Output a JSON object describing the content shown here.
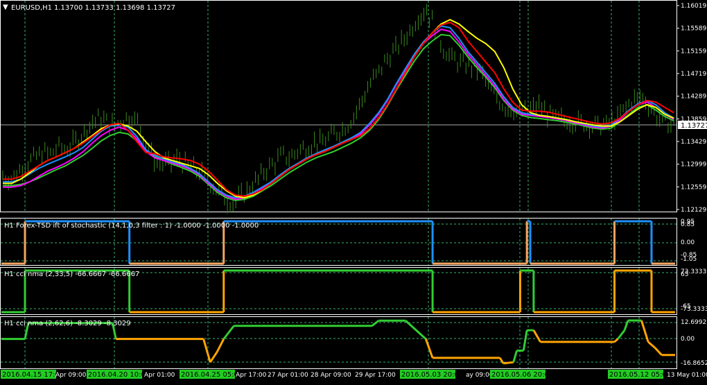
{
  "symbol": "EURUSD,H1",
  "ohlc": "1.13700 1.13733 1.13698 1.13727",
  "current_price": "1.13727",
  "indicators": [
    {
      "label": "H1 Forex-TSD ift of stochastic (14,1,0,3 filter : 1) -1.0000 -1.0000 -1.0000",
      "ticks": [
        "0.95",
        "0.85",
        "0.00",
        "-0.85",
        "-1.05"
      ]
    },
    {
      "label": "H1 cci nma (2,33,5) -66.6667 -66.6667",
      "ticks": [
        "73.3333",
        "65",
        "-65",
        "-73.3333"
      ]
    },
    {
      "label": "H1 cci nma (2,62,6) -8.3029 -8.3029",
      "ticks": [
        "12.6992",
        "0.00",
        "-16.8652"
      ]
    }
  ],
  "colors": {
    "candles": "#3a8a1c",
    "ma_yellow": "#ffff00",
    "ma_red": "#ff0000",
    "ma_blue": "#1e90ff",
    "ma_magenta": "#ff00ff",
    "ma_green": "#32cd32",
    "stoch_up": "#1e90ff",
    "stoch_down": "#f4a460",
    "cci_up": "#32cd32",
    "cci_down": "#ffa500",
    "grid": "#3cb371",
    "time_highlight": "#22cc22"
  },
  "time_labels": [
    {
      "text": "2016.04.15 17:00",
      "highlight": true
    },
    {
      "text": "Apr 09:00",
      "highlight": false
    },
    {
      "text": "2016.04.20 10:00",
      "highlight": true
    },
    {
      "text": "Apr 01:00",
      "highlight": false
    },
    {
      "text": "2016.04.25 05:00",
      "highlight": true
    },
    {
      "text": "Apr 17:00",
      "highlight": false
    },
    {
      "text": "27 Apr 01:00",
      "highlight": false
    },
    {
      "text": "28 Apr 09:00",
      "highlight": false
    },
    {
      "text": "29 Apr 17:00",
      "highlight": false
    },
    {
      "text": "2016.05.03 20:00",
      "highlight": true
    },
    {
      "text": "ay 09:00",
      "highlight": false
    },
    {
      "text": "2016.05.06 20:00",
      "highlight": true
    },
    {
      "text": "2016.05.12 05:00",
      "highlight": true
    },
    {
      "text": "13 May 01:00",
      "highlight": false
    }
  ],
  "chart_data": {
    "type": "line",
    "price_axis": {
      "labels": [
        "1.16019",
        "1.15589",
        "1.15159",
        "1.14719",
        "1.14289",
        "1.13859",
        "1.13429",
        "1.12999",
        "1.12559",
        "1.12129"
      ],
      "min": 1.12129,
      "max": 1.16019
    },
    "price_close": [
      1.1275,
      1.127,
      1.1285,
      1.13,
      1.131,
      1.132,
      1.1318,
      1.133,
      1.1325,
      1.134,
      1.1355,
      1.1375,
      1.1385,
      1.1378,
      1.137,
      1.1382,
      1.139,
      1.1375,
      1.134,
      1.1305,
      1.13,
      1.1298,
      1.131,
      1.1295,
      1.129,
      1.128,
      1.1265,
      1.1245,
      1.123,
      1.1225,
      1.124,
      1.1255,
      1.127,
      1.129,
      1.13,
      1.1315,
      1.131,
      1.1325,
      1.133,
      1.134,
      1.1338,
      1.135,
      1.136,
      1.137,
      1.139,
      1.142,
      1.145,
      1.147,
      1.1495,
      1.151,
      1.153,
      1.155,
      1.1575,
      1.159,
      1.156,
      1.152,
      1.15,
      1.149,
      1.1485,
      1.148,
      1.147,
      1.144,
      1.142,
      1.1405,
      1.14,
      1.1395,
      1.14,
      1.141,
      1.1395,
      1.1385,
      1.1382,
      1.138,
      1.1378,
      1.1375,
      1.1372,
      1.137,
      1.1375,
      1.1385,
      1.1405,
      1.142,
      1.1425,
      1.141,
      1.1385,
      1.1375,
      1.1373
    ],
    "series": [
      {
        "name": "yellow",
        "values": [
          1.1262,
          1.1262,
          1.127,
          1.1282,
          1.1295,
          1.1305,
          1.1312,
          1.132,
          1.1328,
          1.134,
          1.1352,
          1.1365,
          1.1372,
          1.1374,
          1.137,
          1.136,
          1.134,
          1.1322,
          1.131,
          1.1305,
          1.13,
          1.1295,
          1.129,
          1.1278,
          1.1262,
          1.1248,
          1.1238,
          1.1235,
          1.124,
          1.125,
          1.1262,
          1.1275,
          1.1288,
          1.1298,
          1.1308,
          1.1316,
          1.1322,
          1.133,
          1.1338,
          1.1345,
          1.1352,
          1.1365,
          1.1385,
          1.141,
          1.144,
          1.147,
          1.15,
          1.1525,
          1.1545,
          1.1562,
          1.157,
          1.1562,
          1.1548,
          1.1535,
          1.1525,
          1.151,
          1.148,
          1.144,
          1.141,
          1.1395,
          1.139,
          1.1388,
          1.1385,
          1.1382,
          1.1378,
          1.1375,
          1.1372,
          1.137,
          1.137,
          1.1378,
          1.139,
          1.1402,
          1.141,
          1.1405,
          1.1392,
          1.1385
        ]
      },
      {
        "name": "red",
        "values": [
          1.127,
          1.127,
          1.1275,
          1.1285,
          1.1295,
          1.1305,
          1.1312,
          1.132,
          1.1328,
          1.1338,
          1.135,
          1.1362,
          1.1372,
          1.1375,
          1.1362,
          1.134,
          1.132,
          1.1318,
          1.1312,
          1.131,
          1.1308,
          1.1305,
          1.1298,
          1.1285,
          1.1268,
          1.125,
          1.124,
          1.1238,
          1.1242,
          1.125,
          1.1262,
          1.1275,
          1.1288,
          1.1298,
          1.1308,
          1.1316,
          1.1322,
          1.133,
          1.1338,
          1.1345,
          1.1352,
          1.1365,
          1.1385,
          1.141,
          1.144,
          1.147,
          1.15,
          1.1525,
          1.1545,
          1.156,
          1.1565,
          1.1555,
          1.153,
          1.151,
          1.149,
          1.147,
          1.144,
          1.1415,
          1.14,
          1.1398,
          1.1398,
          1.1396,
          1.1392,
          1.1388,
          1.1384,
          1.138,
          1.1376,
          1.1374,
          1.1376,
          1.1385,
          1.1398,
          1.141,
          1.1418,
          1.1415,
          1.1405,
          1.1395
        ]
      },
      {
        "name": "blue",
        "values": [
          1.1265,
          1.1265,
          1.127,
          1.128,
          1.129,
          1.1298,
          1.1305,
          1.1312,
          1.132,
          1.133,
          1.1345,
          1.136,
          1.137,
          1.1372,
          1.1368,
          1.135,
          1.1325,
          1.1315,
          1.1308,
          1.1302,
          1.1298,
          1.129,
          1.128,
          1.1265,
          1.125,
          1.124,
          1.1235,
          1.1238,
          1.1245,
          1.1255,
          1.1265,
          1.1278,
          1.129,
          1.13,
          1.131,
          1.1318,
          1.1325,
          1.1332,
          1.134,
          1.1348,
          1.1358,
          1.1375,
          1.1395,
          1.142,
          1.145,
          1.1478,
          1.1505,
          1.1528,
          1.1545,
          1.1558,
          1.1555,
          1.1535,
          1.151,
          1.149,
          1.147,
          1.145,
          1.1425,
          1.1405,
          1.1395,
          1.1392,
          1.139,
          1.1388,
          1.1385,
          1.1382,
          1.1378,
          1.1374,
          1.137,
          1.1368,
          1.1372,
          1.1385,
          1.14,
          1.1412,
          1.1418,
          1.141,
          1.1395,
          1.1385
        ]
      },
      {
        "name": "magenta",
        "values": [
          1.1255,
          1.1255,
          1.1258,
          1.1265,
          1.1275,
          1.1285,
          1.1292,
          1.13,
          1.131,
          1.1322,
          1.1338,
          1.1352,
          1.1362,
          1.1368,
          1.1362,
          1.1345,
          1.1322,
          1.131,
          1.1305,
          1.13,
          1.1295,
          1.1288,
          1.1278,
          1.1262,
          1.1248,
          1.1238,
          1.1232,
          1.1235,
          1.1242,
          1.1252,
          1.1262,
          1.1275,
          1.1288,
          1.1298,
          1.1308,
          1.1316,
          1.1322,
          1.133,
          1.1338,
          1.1345,
          1.1355,
          1.1372,
          1.1392,
          1.1418,
          1.1448,
          1.1475,
          1.1502,
          1.1525,
          1.154,
          1.1552,
          1.1548,
          1.1528,
          1.1505,
          1.1485,
          1.1465,
          1.1445,
          1.142,
          1.1402,
          1.1392,
          1.139,
          1.1388,
          1.1386,
          1.1383,
          1.138,
          1.1376,
          1.1372,
          1.1368,
          1.1366,
          1.137,
          1.1382,
          1.1398,
          1.141,
          1.1415,
          1.1405,
          1.1392,
          1.1383
        ]
      },
      {
        "name": "green",
        "values": [
          1.1258,
          1.1258,
          1.126,
          1.1265,
          1.1272,
          1.128,
          1.1288,
          1.1295,
          1.1305,
          1.1315,
          1.1328,
          1.1342,
          1.1352,
          1.1358,
          1.1355,
          1.1342,
          1.1325,
          1.1312,
          1.1305,
          1.1298,
          1.1292,
          1.1285,
          1.1275,
          1.126,
          1.1245,
          1.1235,
          1.123,
          1.1232,
          1.1238,
          1.1248,
          1.1258,
          1.127,
          1.1282,
          1.1292,
          1.1302,
          1.131,
          1.1316,
          1.1322,
          1.133,
          1.1338,
          1.1348,
          1.1362,
          1.1382,
          1.1408,
          1.1438,
          1.1465,
          1.1492,
          1.1515,
          1.153,
          1.1542,
          1.154,
          1.1522,
          1.15,
          1.148,
          1.1462,
          1.1442,
          1.1418,
          1.14,
          1.139,
          1.1386,
          1.1384,
          1.1382,
          1.138,
          1.1377,
          1.1374,
          1.137,
          1.1366,
          1.1364,
          1.1366,
          1.1378,
          1.1392,
          1.1405,
          1.141,
          1.14,
          1.1388,
          1.138
        ]
      }
    ],
    "stoch_segments": [
      {
        "from": 0.0,
        "to": 0.035,
        "value": -1,
        "color": "down"
      },
      {
        "from": 0.035,
        "to": 0.19,
        "value": 1,
        "color": "up"
      },
      {
        "from": 0.19,
        "to": 0.33,
        "value": -1,
        "color": "down"
      },
      {
        "from": 0.33,
        "to": 0.64,
        "value": 1,
        "color": "up"
      },
      {
        "from": 0.64,
        "to": 0.78,
        "value": -1,
        "color": "down"
      },
      {
        "from": 0.78,
        "to": 0.785,
        "value": 1,
        "color": "up"
      },
      {
        "from": 0.785,
        "to": 0.91,
        "value": -1,
        "color": "down"
      },
      {
        "from": 0.91,
        "to": 0.965,
        "value": 1,
        "color": "up"
      },
      {
        "from": 0.965,
        "to": 1.0,
        "value": -1,
        "color": "down"
      }
    ],
    "cci1_segments": [
      {
        "from": 0.0,
        "to": 0.035,
        "value": -73.3333,
        "color": "up"
      },
      {
        "from": 0.035,
        "to": 0.19,
        "value": 73.3333,
        "color": "up"
      },
      {
        "from": 0.19,
        "to": 0.33,
        "value": -73.3333,
        "color": "down"
      },
      {
        "from": 0.33,
        "to": 0.64,
        "value": 73.3333,
        "color": "up"
      },
      {
        "from": 0.64,
        "to": 0.77,
        "value": -73.3333,
        "color": "down"
      },
      {
        "from": 0.77,
        "to": 0.79,
        "value": 73.3333,
        "color": "up"
      },
      {
        "from": 0.79,
        "to": 0.91,
        "value": -73.3333,
        "color": "down"
      },
      {
        "from": 0.91,
        "to": 0.965,
        "value": 73.3333,
        "color": "down"
      },
      {
        "from": 0.965,
        "to": 1.0,
        "value": -73.3333,
        "color": "down"
      }
    ],
    "cci2_points": [
      [
        0.0,
        0.0,
        "up"
      ],
      [
        0.035,
        0.0,
        "up"
      ],
      [
        0.04,
        11,
        "up"
      ],
      [
        0.165,
        11,
        "up"
      ],
      [
        0.17,
        0,
        "down"
      ],
      [
        0.3,
        0,
        "down"
      ],
      [
        0.31,
        -16,
        "down"
      ],
      [
        0.32,
        -9,
        "down"
      ],
      [
        0.33,
        0,
        "up"
      ],
      [
        0.345,
        9,
        "up"
      ],
      [
        0.55,
        9,
        "up"
      ],
      [
        0.56,
        12.6,
        "up"
      ],
      [
        0.6,
        12.6,
        "up"
      ],
      [
        0.63,
        0,
        "down"
      ],
      [
        0.64,
        -13,
        "down"
      ],
      [
        0.74,
        -13,
        "down"
      ],
      [
        0.745,
        -16.8,
        "down"
      ],
      [
        0.76,
        -16,
        "up"
      ],
      [
        0.765,
        -8,
        "up"
      ],
      [
        0.775,
        -8,
        "up"
      ],
      [
        0.78,
        6,
        "up"
      ],
      [
        0.79,
        6,
        "down"
      ],
      [
        0.8,
        -2,
        "down"
      ],
      [
        0.91,
        -2,
        "down"
      ],
      [
        0.915,
        0,
        "up"
      ],
      [
        0.925,
        6,
        "up"
      ],
      [
        0.93,
        12.7,
        "up"
      ],
      [
        0.95,
        12.7,
        "down"
      ],
      [
        0.96,
        -2,
        "down"
      ],
      [
        0.97,
        -6,
        "down"
      ],
      [
        0.98,
        -11,
        "down"
      ],
      [
        1.0,
        -11,
        "down"
      ]
    ]
  }
}
